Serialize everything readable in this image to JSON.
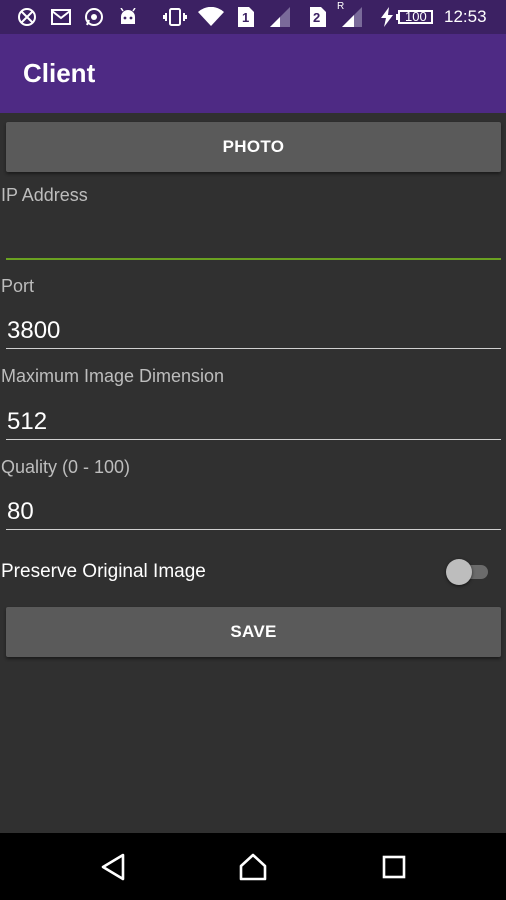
{
  "status_bar": {
    "time": "12:53",
    "battery": "100",
    "sim1": "1",
    "sim2": "2",
    "roaming": "R",
    "icons": [
      "blocked-app-icon",
      "gmail-icon",
      "whatsapp-icon",
      "android-debug-icon",
      "vibrate-icon",
      "wifi-icon",
      "sim1-icon",
      "signal-icon",
      "sim2-icon",
      "signal-roaming-icon",
      "charging-icon",
      "battery-icon"
    ]
  },
  "app_bar": {
    "title": "Client"
  },
  "form": {
    "photo_button": "PHOTO",
    "ip_label": "IP Address",
    "ip_value": "",
    "port_label": "Port",
    "port_value": "3800",
    "max_dim_label": "Maximum Image Dimension",
    "max_dim_value": "512",
    "quality_label": "Quality (0 - 100)",
    "quality_value": "80",
    "preserve_label": "Preserve Original Image",
    "preserve_on": false,
    "save_button": "SAVE"
  },
  "colors": {
    "status_bar": "#3c2163",
    "app_bar": "#4e2a84",
    "background": "#303030",
    "button": "#5a5a5a",
    "focus_accent": "#6aa121"
  },
  "nav_bar": {
    "icons": [
      "back-icon",
      "home-icon",
      "recents-icon"
    ]
  }
}
